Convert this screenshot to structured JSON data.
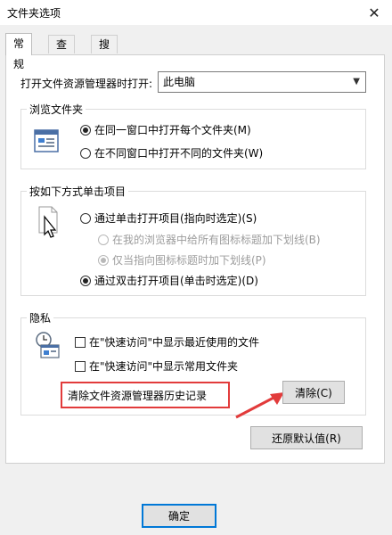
{
  "window": {
    "title": "文件夹选项",
    "close_glyph": "✕"
  },
  "tabs": [
    {
      "label": "常规",
      "active": true
    },
    {
      "label": "查看",
      "active": false
    },
    {
      "label": "搜索",
      "active": false
    }
  ],
  "general": {
    "open_explorer_label": "打开文件资源管理器时打开:",
    "open_explorer_value": "此电脑",
    "browse_folders": {
      "title": "浏览文件夹",
      "options": [
        {
          "label": "在同一窗口中打开每个文件夹(M)",
          "checked": true
        },
        {
          "label": "在不同窗口中打开不同的文件夹(W)",
          "checked": false
        }
      ]
    },
    "click_items": {
      "title": "按如下方式单击项目",
      "options": [
        {
          "label": "通过单击打开项目(指向时选定)(S)",
          "checked": false
        },
        {
          "label": "在我的浏览器中给所有图标标题加下划线(B)",
          "checked": false
        },
        {
          "label": "仅当指向图标标题时加下划线(P)",
          "checked": true
        },
        {
          "label": "通过双击打开项目(单击时选定)(D)",
          "checked": true
        }
      ]
    },
    "privacy": {
      "title": "隐私",
      "options": [
        {
          "label": "在\"快速访问\"中显示最近使用的文件",
          "checked": false
        },
        {
          "label": "在\"快速访问\"中显示常用文件夹",
          "checked": false
        }
      ],
      "clear_history_label": "清除文件资源管理器历史记录",
      "clear_button": "清除(C)"
    },
    "restore_defaults_button": "还原默认值(R)"
  },
  "footer": {
    "ok_button": "确定"
  },
  "colors": {
    "highlight": "#e23b3b",
    "focus": "#0078d7"
  }
}
